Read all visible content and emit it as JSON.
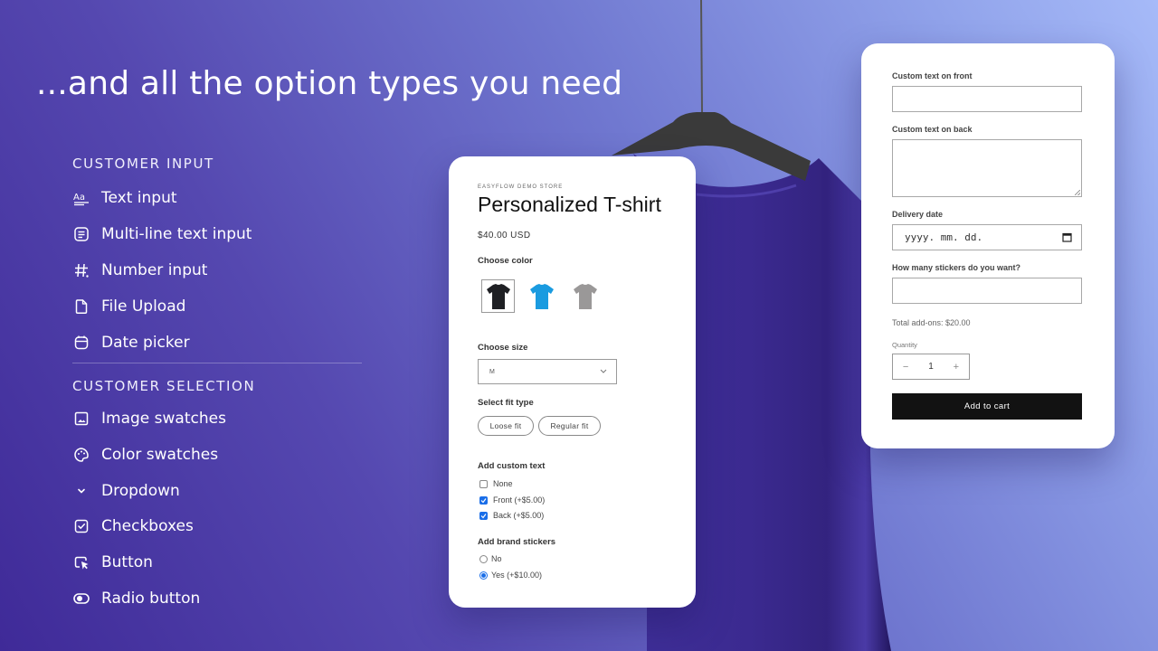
{
  "headline": "...and all the option types you need",
  "sections": {
    "customer_input": {
      "title": "CUSTOMER INPUT",
      "items": [
        {
          "label": "Text input",
          "icon": "text-format-icon"
        },
        {
          "label": "Multi-line text input",
          "icon": "multiline-text-icon"
        },
        {
          "label": "Number input",
          "icon": "hash-icon"
        },
        {
          "label": "File Upload",
          "icon": "file-icon"
        },
        {
          "label": "Date picker",
          "icon": "calendar-icon"
        }
      ]
    },
    "customer_selection": {
      "title": "CUSTOMER SELECTION",
      "items": [
        {
          "label": "Image swatches",
          "icon": "image-icon"
        },
        {
          "label": "Color swatches",
          "icon": "palette-icon"
        },
        {
          "label": "Dropdown",
          "icon": "chevron-down-icon"
        },
        {
          "label": "Checkboxes",
          "icon": "checkbox-icon"
        },
        {
          "label": "Button",
          "icon": "cursor-click-icon"
        },
        {
          "label": "Radio button",
          "icon": "toggle-icon"
        }
      ]
    }
  },
  "product_card": {
    "store_name": "EASYFLOW DEMO STORE",
    "title": "Personalized T-shirt",
    "price": "$40.00 USD",
    "color_label": "Choose color",
    "colors": [
      {
        "name": "Black",
        "hex": "#1f2024",
        "selected": true
      },
      {
        "name": "Blue",
        "hex": "#1a9be0",
        "selected": false
      },
      {
        "name": "Gray",
        "hex": "#9a9898",
        "selected": false
      }
    ],
    "size_label": "Choose size",
    "size_value": "M",
    "fit_label": "Select fit type",
    "fit_options": [
      "Loose fit",
      "Regular fit"
    ],
    "custom_text_label": "Add custom text",
    "custom_text_options": [
      {
        "label": "None",
        "checked": false
      },
      {
        "label": "Front (+$5.00)",
        "checked": true
      },
      {
        "label": "Back (+$5.00)",
        "checked": true
      }
    ],
    "stickers_label": "Add brand stickers",
    "stickers_options": [
      {
        "label": "No",
        "checked": false
      },
      {
        "label": "Yes (+$10.00)",
        "checked": true
      }
    ]
  },
  "form_card": {
    "front_label": "Custom text on front",
    "front_value": "",
    "back_label": "Custom text on back",
    "back_value": "",
    "date_label": "Delivery date",
    "date_placeholder": "yyyy. mm. dd.",
    "stickers_label": "How many stickers do you want?",
    "stickers_value": "",
    "total_addons": "Total add-ons: $20.00",
    "quantity_label": "Quantity",
    "quantity_value": "1",
    "minus": "−",
    "plus": "+",
    "add_to_cart": "Add to cart"
  },
  "colors": {
    "accent_checkbox": "#1a6ee8",
    "cart_button": "#121212",
    "shirt": "#3d2c94",
    "hanger": "#3a3a3a"
  }
}
